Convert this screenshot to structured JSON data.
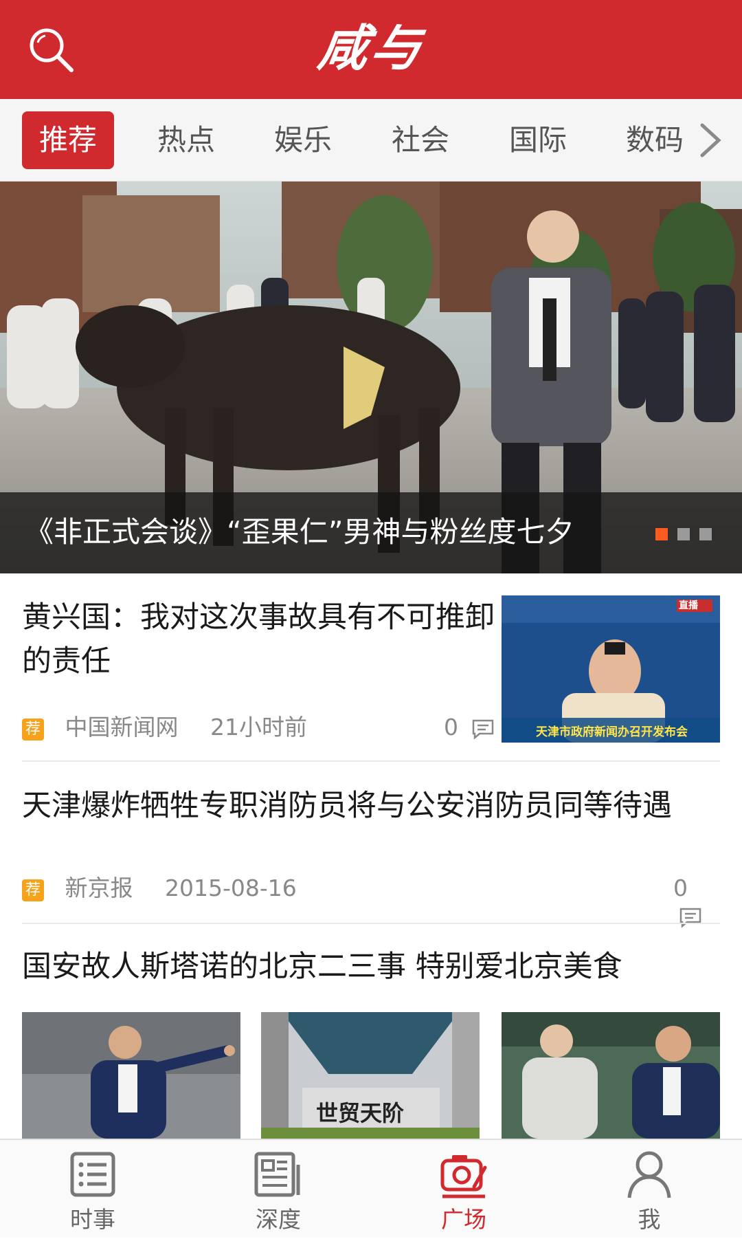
{
  "app": {
    "logo": "咸与"
  },
  "tabs": [
    {
      "label": "推荐",
      "active": true
    },
    {
      "label": "热点"
    },
    {
      "label": "娱乐"
    },
    {
      "label": "社会"
    },
    {
      "label": "国际"
    },
    {
      "label": "数码"
    }
  ],
  "banner": {
    "title": "《非正式会谈》“歪果仁”男神与粉丝度七夕",
    "page_count": 3,
    "current_page": 1
  },
  "news": [
    {
      "title": "黄兴国：我对这次事故具有不可推卸的责任",
      "badge": "荐",
      "source": "中国新闻网",
      "time": "21小时前",
      "comments": "0",
      "thumb_overlay": "天津市政府新闻办召开发布会",
      "thumb_tag": "直播"
    },
    {
      "title": "天津爆炸牺牲专职消防员将与公安消防员同等待遇",
      "badge": "荐",
      "source": "新京报",
      "time": "2015-08-16",
      "comments": "0"
    },
    {
      "title": "国安故人斯塔诺的北京二三事 特别爱北京美食",
      "thumb2_sign": "世贸天阶"
    }
  ],
  "bottom_nav": [
    {
      "label": "时事",
      "icon": "news-list-icon"
    },
    {
      "label": "深度",
      "icon": "article-icon"
    },
    {
      "label": "广场",
      "icon": "camera-icon",
      "active": true
    },
    {
      "label": "我",
      "icon": "user-icon"
    }
  ],
  "colors": {
    "brand": "#d12a2e",
    "badge": "#f6a21a",
    "dot_active": "#ff5a1f"
  }
}
